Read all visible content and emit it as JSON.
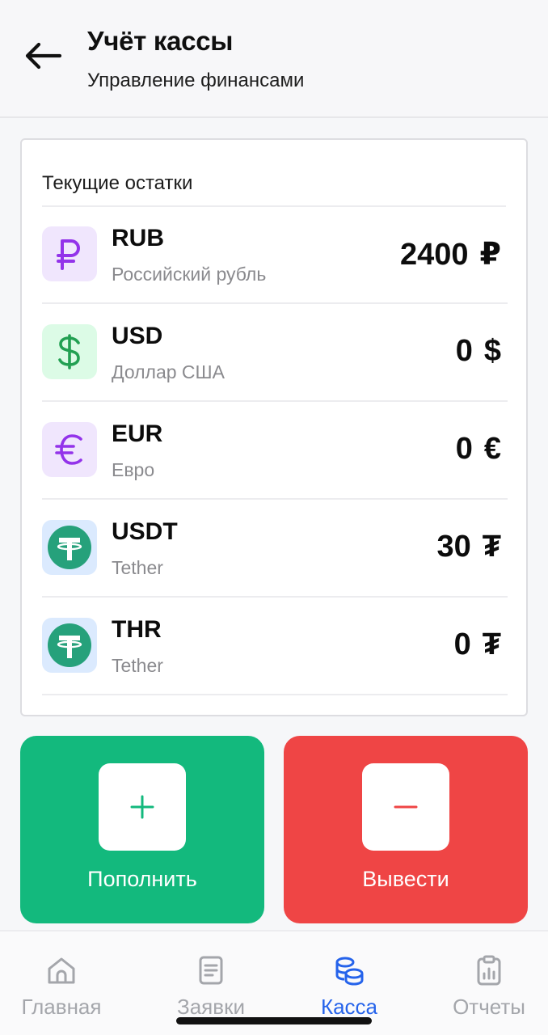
{
  "header": {
    "title": "Учёт кассы",
    "subtitle": "Управление финансами"
  },
  "balances": {
    "title": "Текущие остатки",
    "items": [
      {
        "code": "RUB",
        "name": "Российский рубль",
        "amount": "2400",
        "symbol": "₽",
        "icon": "ruble-icon",
        "icon_bg": "#f0e6fd",
        "icon_color": "#9333ea"
      },
      {
        "code": "USD",
        "name": "Доллар США",
        "amount": "0",
        "symbol": "$",
        "icon": "dollar-icon",
        "icon_bg": "#dcfbe6",
        "icon_color": "#22a052"
      },
      {
        "code": "EUR",
        "name": "Евро",
        "amount": "0",
        "symbol": "€",
        "icon": "euro-icon",
        "icon_bg": "#f0e6fd",
        "icon_color": "#9333ea"
      },
      {
        "code": "USDT",
        "name": "Tether",
        "amount": "30",
        "symbol": "₮",
        "icon": "tether-icon",
        "icon_bg": "#dbeafe",
        "icon_color": "#26a17b"
      },
      {
        "code": "THR",
        "name": "Tether",
        "amount": "0",
        "symbol": "₮",
        "icon": "tether-icon",
        "icon_bg": "#dbeafe",
        "icon_color": "#26a17b"
      }
    ]
  },
  "actions": {
    "deposit_label": "Пополнить",
    "deposit_symbol": "+",
    "deposit_color": "#13b97d",
    "withdraw_label": "Вывести",
    "withdraw_symbol": "−",
    "withdraw_color": "#ef4545"
  },
  "nav": {
    "items": [
      {
        "label": "Главная",
        "icon": "home-icon",
        "active": false
      },
      {
        "label": "Заявки",
        "icon": "document-icon",
        "active": false
      },
      {
        "label": "Касса",
        "icon": "coins-icon",
        "active": true
      },
      {
        "label": "Отчеты",
        "icon": "clipboard-chart-icon",
        "active": false
      }
    ],
    "active_color": "#2563eb",
    "inactive_color": "#a4a6ab"
  }
}
